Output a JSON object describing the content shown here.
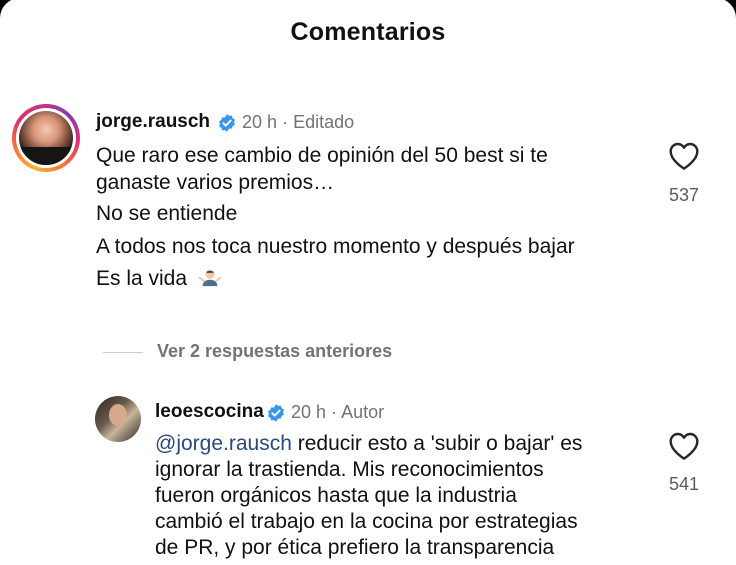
{
  "header": {
    "title": "Comentarios"
  },
  "comments": [
    {
      "username": "jorge.rausch",
      "time": "20 h",
      "separator": "·",
      "status": "Editado",
      "lines": [
        "Que raro ese cambio de opinión del 50 best si te",
        "ganaste varios premios…",
        "No se entiende",
        "A todos nos toca nuestro momento y después bajar",
        "Es la vida"
      ],
      "emoji": "man-shrugging-emoji",
      "likes": "537"
    },
    {
      "username": "leoescocina",
      "time": "20 h",
      "separator": "·",
      "status": "Autor",
      "mention": "@jorge.rausch",
      "lines": [
        " reducir esto a 'subir o bajar' es",
        "ignorar la trastienda. Mis reconocimientos",
        "fueron orgánicos hasta que la industria",
        "cambió el trabajo en la cocina por estrategias",
        "de PR, y por ética prefiero la transparencia"
      ],
      "likes": "541"
    }
  ],
  "view_replies": "Ver 2 respuestas anteriores",
  "colors": {
    "verified": "#3797f0",
    "mention": "#2a4a7b",
    "meta": "#737373"
  }
}
